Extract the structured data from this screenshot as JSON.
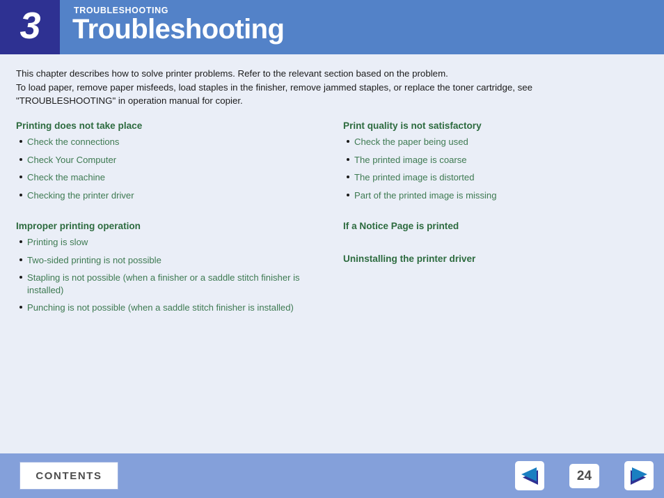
{
  "header": {
    "chapter_number": "3",
    "eyebrow": "TROUBLESHOOTING",
    "title": "Troubleshooting",
    "number_box_color": "#2e3192",
    "banner_color": "#5382c8"
  },
  "intro": {
    "line1": "This chapter describes how to solve printer problems. Refer to the relevant section based on the problem.",
    "line2": "To load paper, remove paper misfeeds, load staples in the finisher, remove jammed staples, or replace the toner cartridge, see",
    "line3": "\"TROUBLESHOOTING\" in operation manual for copier."
  },
  "columns": {
    "left": [
      {
        "heading": "Printing does not take place",
        "items": [
          "Check the connections",
          "Check Your Computer",
          "Check the machine",
          "Checking the printer driver"
        ]
      },
      {
        "heading": "Improper printing operation",
        "items": [
          "Printing is slow",
          "Two-sided printing is not possible",
          "Stapling is not possible (when a finisher or a saddle stitch finisher is installed)",
          "Punching is not possible (when a saddle stitch finisher is installed)"
        ]
      }
    ],
    "right": [
      {
        "heading": "Print quality is not satisfactory",
        "items": [
          "Check the paper being used",
          "The printed image is coarse",
          "The printed image is distorted",
          "Part of the printed image is missing"
        ]
      },
      {
        "heading": "If a Notice Page is printed",
        "items": []
      },
      {
        "heading": "Uninstalling the printer driver",
        "items": []
      }
    ]
  },
  "footer": {
    "contents_label": "CONTENTS",
    "page_number": "24",
    "prev_icon": "triangle-left-icon",
    "next_icon": "triangle-right-icon",
    "bar_color": "#84a0da"
  },
  "theme": {
    "background": "#eaeef7",
    "heading_green": "#2d6b3f",
    "link_green": "#3e7a52",
    "nav_blue": "#1a7fc1",
    "nav_shadow": "#2e3192"
  }
}
